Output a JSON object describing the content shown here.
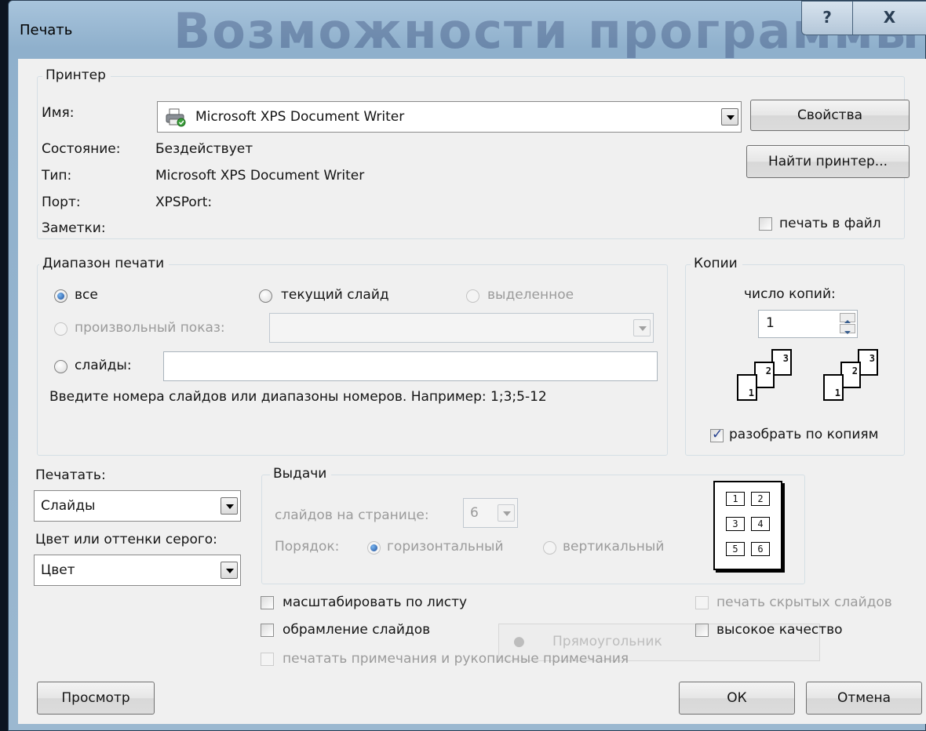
{
  "window": {
    "title": "Печать",
    "background_text": "Возможности программы",
    "help_label": "?",
    "close_label": "X"
  },
  "printer": {
    "legend": "Принтер",
    "name_label": "Имя:",
    "name_value": "Microsoft XPS Document Writer",
    "status_label": "Состояние:",
    "status_value": "Бездействует",
    "type_label": "Тип:",
    "type_value": "Microsoft XPS Document Writer",
    "port_label": "Порт:",
    "port_value": "XPSPort:",
    "notes_label": "Заметки:",
    "properties_button": "Свойства",
    "find_printer_button": "Найти принтер...",
    "print_to_file_label": "печать в файл",
    "print_to_file_checked": false
  },
  "range": {
    "legend": "Диапазон печати",
    "all_label": "все",
    "current_slide_label": "текущий слайд",
    "selection_label": "выделенное",
    "custom_show_label": "произвольный показ:",
    "custom_show_value": "",
    "slides_label": "слайды:",
    "slides_value": "",
    "hint": "Введите номера слайдов или диапазоны номеров. Например: 1;3;5-12",
    "selected": "all"
  },
  "copies": {
    "legend": "Копии",
    "count_label": "число копий:",
    "count_value": "1",
    "collate_label": "разобрать по копиям",
    "collate_checked": true,
    "page_labels": [
      "1",
      "2",
      "3"
    ]
  },
  "print_what": {
    "label": "Печатать:",
    "value": "Слайды",
    "color_label": "Цвет или оттенки серого:",
    "color_value": "Цвет"
  },
  "handouts": {
    "legend": "Выдачи",
    "per_page_label": "слайдов на странице:",
    "per_page_value": "6",
    "order_label": "Порядок:",
    "horizontal_label": "горизонтальный",
    "vertical_label": "вертикальный",
    "order_selected": "horizontal",
    "preview_cells": [
      "1",
      "2",
      "3",
      "4",
      "5",
      "6"
    ]
  },
  "options": {
    "scale_to_fit": "масштабировать по листу",
    "frame_slides": "обрамление слайдов",
    "print_comments": "печатать примечания и рукописные примечания",
    "print_hidden": "печать скрытых слайдов",
    "high_quality": "высокое качество"
  },
  "ghost": {
    "label": "Прямоугольник"
  },
  "buttons": {
    "preview": "Просмотр",
    "ok": "ОК",
    "cancel": "Отмена"
  }
}
